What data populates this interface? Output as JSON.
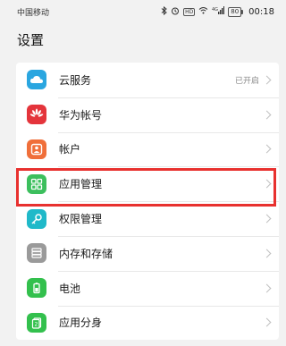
{
  "status_bar": {
    "carrier": "中国移动",
    "battery": "80",
    "time": "00:18",
    "hd_label": "HD",
    "signal_label": "4G"
  },
  "page": {
    "title": "设置"
  },
  "items": [
    {
      "label": "云服务",
      "status": "已开启",
      "icon": "cloud-icon",
      "color": "#2aa6e0"
    },
    {
      "label": "华为帐号",
      "status": "",
      "icon": "huawei-logo-icon",
      "color": "#e4343b"
    },
    {
      "label": "帐户",
      "status": "",
      "icon": "user-icon",
      "color": "#f06f3a"
    },
    {
      "label": "应用管理",
      "status": "",
      "icon": "apps-grid-icon",
      "color": "#3cbf5d"
    },
    {
      "label": "权限管理",
      "status": "",
      "icon": "key-icon",
      "color": "#20b9c9"
    },
    {
      "label": "内存和存储",
      "status": "",
      "icon": "storage-icon",
      "color": "#9a9a9a"
    },
    {
      "label": "电池",
      "status": "",
      "icon": "battery-icon",
      "color": "#33c04d"
    },
    {
      "label": "应用分身",
      "status": "",
      "icon": "app-twin-icon",
      "color": "#33c04d"
    }
  ],
  "highlight": {
    "target": "应用管理",
    "color": "#e8312f"
  }
}
